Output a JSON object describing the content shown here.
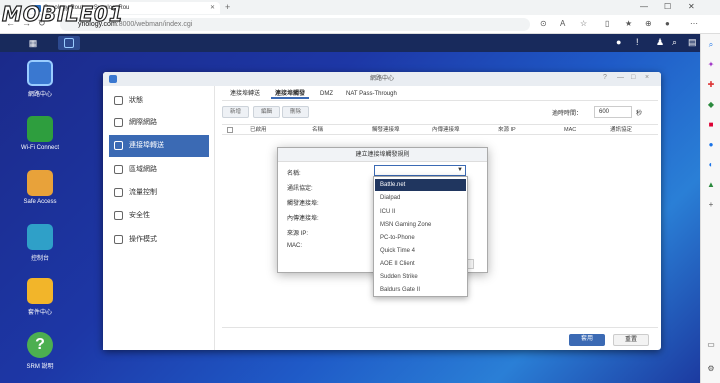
{
  "browser": {
    "tab_title": "Synology Router - SynologyRou",
    "address_host": "ynology.com",
    "address_path": ":8000/webman/index.cgi",
    "watermark": "MOBILE01"
  },
  "window": {
    "title": "網路中心",
    "controls": [
      "?",
      "—",
      "□",
      "×"
    ]
  },
  "sidebar": {
    "items": [
      {
        "label": "狀態",
        "icon": "status-icon"
      },
      {
        "label": "網際網路",
        "icon": "globe-icon"
      },
      {
        "label": "連接埠轉送",
        "icon": "forward-arrow-icon",
        "active": true
      },
      {
        "label": "區域網路",
        "icon": "network-icon"
      },
      {
        "label": "流量控制",
        "icon": "traffic-icon"
      },
      {
        "label": "安全性",
        "icon": "shield-icon"
      },
      {
        "label": "操作模式",
        "icon": "mode-icon"
      }
    ]
  },
  "tabs": [
    "連接埠轉送",
    "連接埠觸發",
    "DMZ",
    "NAT Pass-Through"
  ],
  "toolbar": {
    "create": "新增",
    "edit": "編輯",
    "delete": "刪除",
    "timeout_label": "逾時時間：",
    "timeout_value": "600",
    "timeout_unit": "秒"
  },
  "table_headers": [
    "已啟用",
    "名稱",
    "觸發連接埠",
    "內傳連接埠",
    "來源 IP",
    "MAC",
    "通訊協定"
  ],
  "footer": {
    "apply": "套用",
    "reset": "重置"
  },
  "modal": {
    "title": "建立連接埠觸發規則",
    "fields": [
      "名稱:",
      "通訊協定:",
      "觸發連接埠:",
      "內傳連接埠:",
      "來源 IP:",
      "MAC:"
    ]
  },
  "dropdown": {
    "options": [
      "Battle.net",
      "Dialpad",
      "ICU II",
      "MSN Gaming Zone",
      "PC-to-Phone",
      "Quick Time 4",
      "AOE II Client",
      "Sudden Strike",
      "Baldurs Gate II"
    ],
    "selected": "Battle.net"
  },
  "desktop_icons": [
    "網路中心",
    "Wi-Fi Connect",
    "Safe Access",
    "控制台",
    "套件中心",
    "SRM 說明"
  ],
  "colors": {
    "accent": "#3b6ab4",
    "selected": "#20365f",
    "topbar": "#182a5c"
  }
}
